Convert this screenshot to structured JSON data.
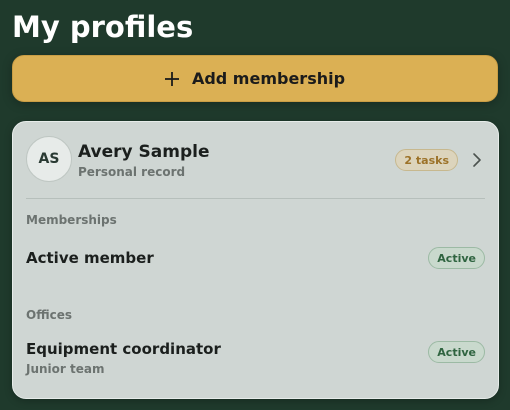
{
  "header": {
    "title": "My profiles"
  },
  "actions": {
    "add_label": "Add membership",
    "add_icon": "plus-icon"
  },
  "profile": {
    "initials": "AS",
    "name": "Avery Sample",
    "subtitle": "Personal record",
    "tasks_badge": "2 tasks",
    "chevron_icon": "chevron-right-icon"
  },
  "memberships": {
    "section_label": "Memberships",
    "items": [
      {
        "title": "Active member",
        "status": "Active"
      }
    ]
  },
  "offices": {
    "section_label": "Offices",
    "items": [
      {
        "title": "Equipment coordinator",
        "subtitle": "Junior team",
        "status": "Active"
      }
    ]
  },
  "colors": {
    "background": "#1f3a2c",
    "accent": "#dbb054",
    "card": "#cfd6d3",
    "active_badge_text": "#2f6440",
    "tasks_badge_text": "#9c7228"
  }
}
